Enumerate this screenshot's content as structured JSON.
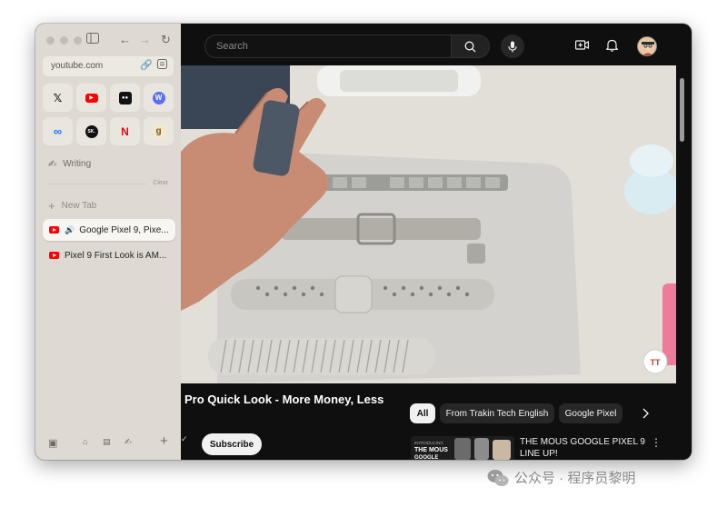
{
  "sidebar": {
    "url": "youtube.com",
    "favorites": [
      {
        "icon": "x-logo-icon",
        "glyph": "𝕏",
        "bg": "#e9e6e0",
        "fg": "#111111"
      },
      {
        "icon": "youtube-logo-icon",
        "glyph": "▶",
        "bg": "#ff0000",
        "fg": "#ffffff"
      },
      {
        "icon": "medium-logo-icon",
        "glyph": "●●",
        "bg": "#111111",
        "fg": "#ffffff"
      },
      {
        "icon": "wordpress-logo-icon",
        "glyph": "W",
        "bg": "#5b6ef5",
        "fg": "#ffffff"
      },
      {
        "icon": "meta-logo-icon",
        "glyph": "∞",
        "bg": "#e9e6e0",
        "fg": "#1877f2"
      },
      {
        "icon": "sk-logo-icon",
        "glyph": "SK.",
        "bg": "#111111",
        "fg": "#ffffff"
      },
      {
        "icon": "netflix-logo-icon",
        "glyph": "N",
        "bg": "#e9e6e0",
        "fg": "#e50914"
      },
      {
        "icon": "g-logo-icon",
        "glyph": "g",
        "bg": "#f3e9c6",
        "fg": "#6b5a2b"
      }
    ],
    "folder_label": "Writing",
    "clear_label": "Clear",
    "new_tab_label": "New Tab",
    "tabs": [
      {
        "label": "Google Pixel 9, Pixe...",
        "active": true,
        "playing": true
      },
      {
        "label": "Pixel 9 First Look is AM...",
        "active": false,
        "playing": false
      }
    ]
  },
  "header": {
    "search_placeholder": "Search"
  },
  "video": {
    "title": "Pro Quick Look - More Money, Less",
    "subscribe_label": "Subscribe"
  },
  "chips": [
    {
      "label": "All",
      "selected": true
    },
    {
      "label": "From Trakin Tech English",
      "selected": false
    },
    {
      "label": "Google Pixel",
      "selected": false
    }
  ],
  "recommendation": {
    "title": "THE MOUS GOOGLE PIXEL 9 LINE UP!",
    "thumb_text": "INTRODUCING THE MOUS GOOGLE"
  },
  "watermark": {
    "text": "公众号 · 程序员黎明"
  },
  "colors": {
    "accent_red": "#ff0000",
    "sidebar_bg": "#dedad3",
    "youtube_bg": "#0f0f0f"
  }
}
